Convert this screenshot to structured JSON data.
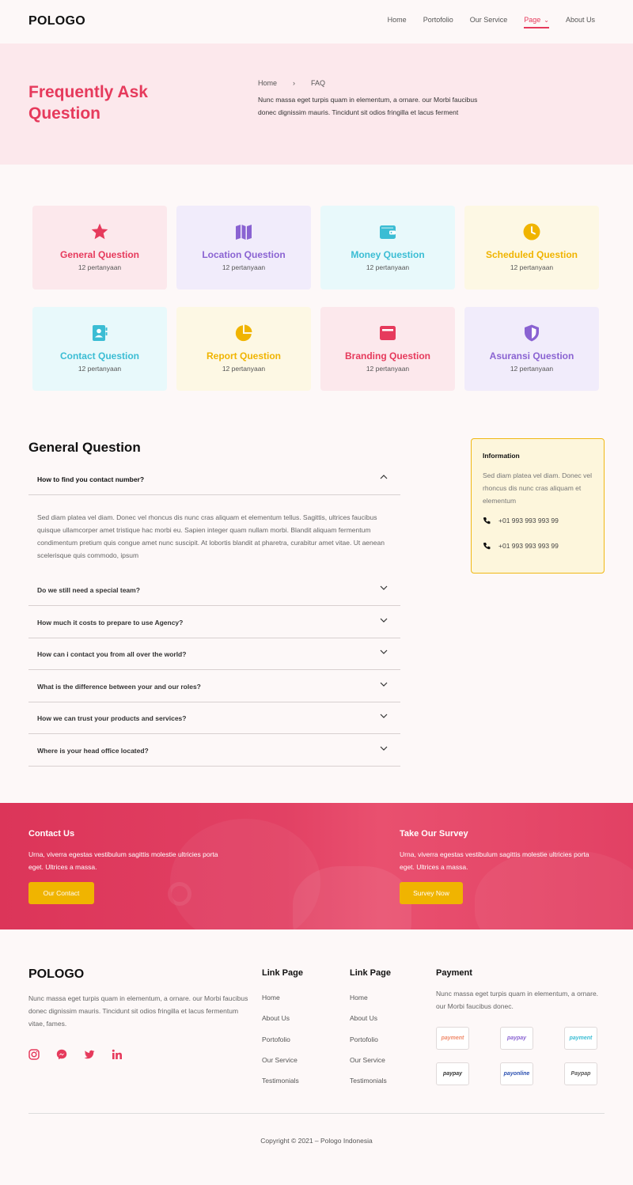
{
  "header": {
    "logo": "POLOGO",
    "nav": [
      "Home",
      "Portofolio",
      "Our Service",
      "Page",
      "About Us"
    ],
    "active": "Page"
  },
  "hero": {
    "title": "Frequently Ask Question",
    "breadcrumb": {
      "home": "Home",
      "sep": "›",
      "current": "FAQ"
    },
    "desc": "Nunc massa eget turpis quam in elementum, a ornare. our Morbi faucibus donec dignissim mauris. Tincidunt sit odios fringilla et lacus ferment"
  },
  "categories": [
    {
      "title": "General Question",
      "sub": "12 pertanyaan",
      "icon": "star-icon",
      "color": "#e63a5c",
      "bg": "#fce8ec"
    },
    {
      "title": "Location Question",
      "sub": "12 pertanyaan",
      "icon": "map-icon",
      "color": "#8a63d2",
      "bg": "#f1ecfb"
    },
    {
      "title": "Money Question",
      "sub": "12 pertanyaan",
      "icon": "wallet-icon",
      "color": "#3bbdd4",
      "bg": "#e8f9fb"
    },
    {
      "title": "Scheduled Question",
      "sub": "12 pertanyaan",
      "icon": "clock-icon",
      "color": "#f0b400",
      "bg": "#fdf8e4"
    },
    {
      "title": "Contact Question",
      "sub": "12 pertanyaan",
      "icon": "contact-book-icon",
      "color": "#3bbdd4",
      "bg": "#e8f9fb"
    },
    {
      "title": "Report Question",
      "sub": "12 pertanyaan",
      "icon": "pie-chart-icon",
      "color": "#f0b400",
      "bg": "#fdf8e4"
    },
    {
      "title": "Branding Question",
      "sub": "12 pertanyaan",
      "icon": "card-icon",
      "color": "#e63a5c",
      "bg": "#fce8ec"
    },
    {
      "title": "Asuransi Question",
      "sub": "12 pertanyaan",
      "icon": "shield-icon",
      "color": "#8a63d2",
      "bg": "#f1ecfb"
    }
  ],
  "faq": {
    "title": "General Question",
    "open_question": "How to find you contact number?",
    "open_answer": "Sed diam platea vel diam. Donec vel rhoncus dis nunc cras aliquam et elementum tellus. Sagittis, ultrices faucibus quisque ullamcorper amet tristique hac morbi eu. Sapien integer quam nullam morbi. Blandit aliquam fermentum condimentum pretium quis congue amet nunc suscipit. At lobortis blandit at pharetra, curabitur amet vitae. Ut aenean scelerisque quis commodo, ipsum",
    "questions": [
      "Do we still need a special team?",
      "How much it costs to prepare to use Agency?",
      "How can i contact you from all over the world?",
      "What is the difference between your and our roles?",
      "How we can trust your products and services?",
      "Where is your head office located?"
    ]
  },
  "info": {
    "title": "Information",
    "desc": "Sed diam platea vel diam. Donec vel rhoncus dis nunc cras aliquam et elementum",
    "phones": [
      "+01 993 993 993 99",
      "+01 993 993 993 99"
    ]
  },
  "cta": {
    "contact": {
      "title": "Contact Us",
      "desc": "Urna, viverra egestas vestibulum sagittis molestie ultricies porta eget. Ultrices a massa.",
      "button": "Our Contact"
    },
    "survey": {
      "title": "Take Our Survey",
      "desc": "Urna, viverra egestas vestibulum sagittis molestie ultricies porta eget. Ultrices a massa.",
      "button": "Survey Now"
    }
  },
  "footer": {
    "logo": "POLOGO",
    "desc": "Nunc massa eget turpis quam in elementum, a ornare. our Morbi faucibus donec dignissim mauris. Tincidunt sit odios fringilla et lacus fermentum vitae, fames.",
    "social": [
      "instagram-icon",
      "messenger-icon",
      "twitter-icon",
      "linkedin-icon"
    ],
    "col1": {
      "title": "Link Page",
      "links": [
        "Home",
        "About Us",
        "Portofolio",
        "Our Service",
        "Testimonials"
      ]
    },
    "col2": {
      "title": "Link Page",
      "links": [
        "Home",
        "About Us",
        "Portofolio",
        "Our Service",
        "Testimonials"
      ]
    },
    "payment": {
      "title": "Payment",
      "desc": "Nunc massa eget turpis quam in elementum, a ornare. our Morbi faucibus donec.",
      "logos": [
        "payment",
        "paypay",
        "payment",
        "paypay",
        "payonline",
        "Paypap"
      ],
      "logo_colors": [
        "#f08a6a",
        "#8a63d2",
        "#3bbdd4",
        "#333",
        "#2a4fb0",
        "#555"
      ]
    },
    "copyright": "Copyright © 2021 – Pologo Indonesia"
  }
}
